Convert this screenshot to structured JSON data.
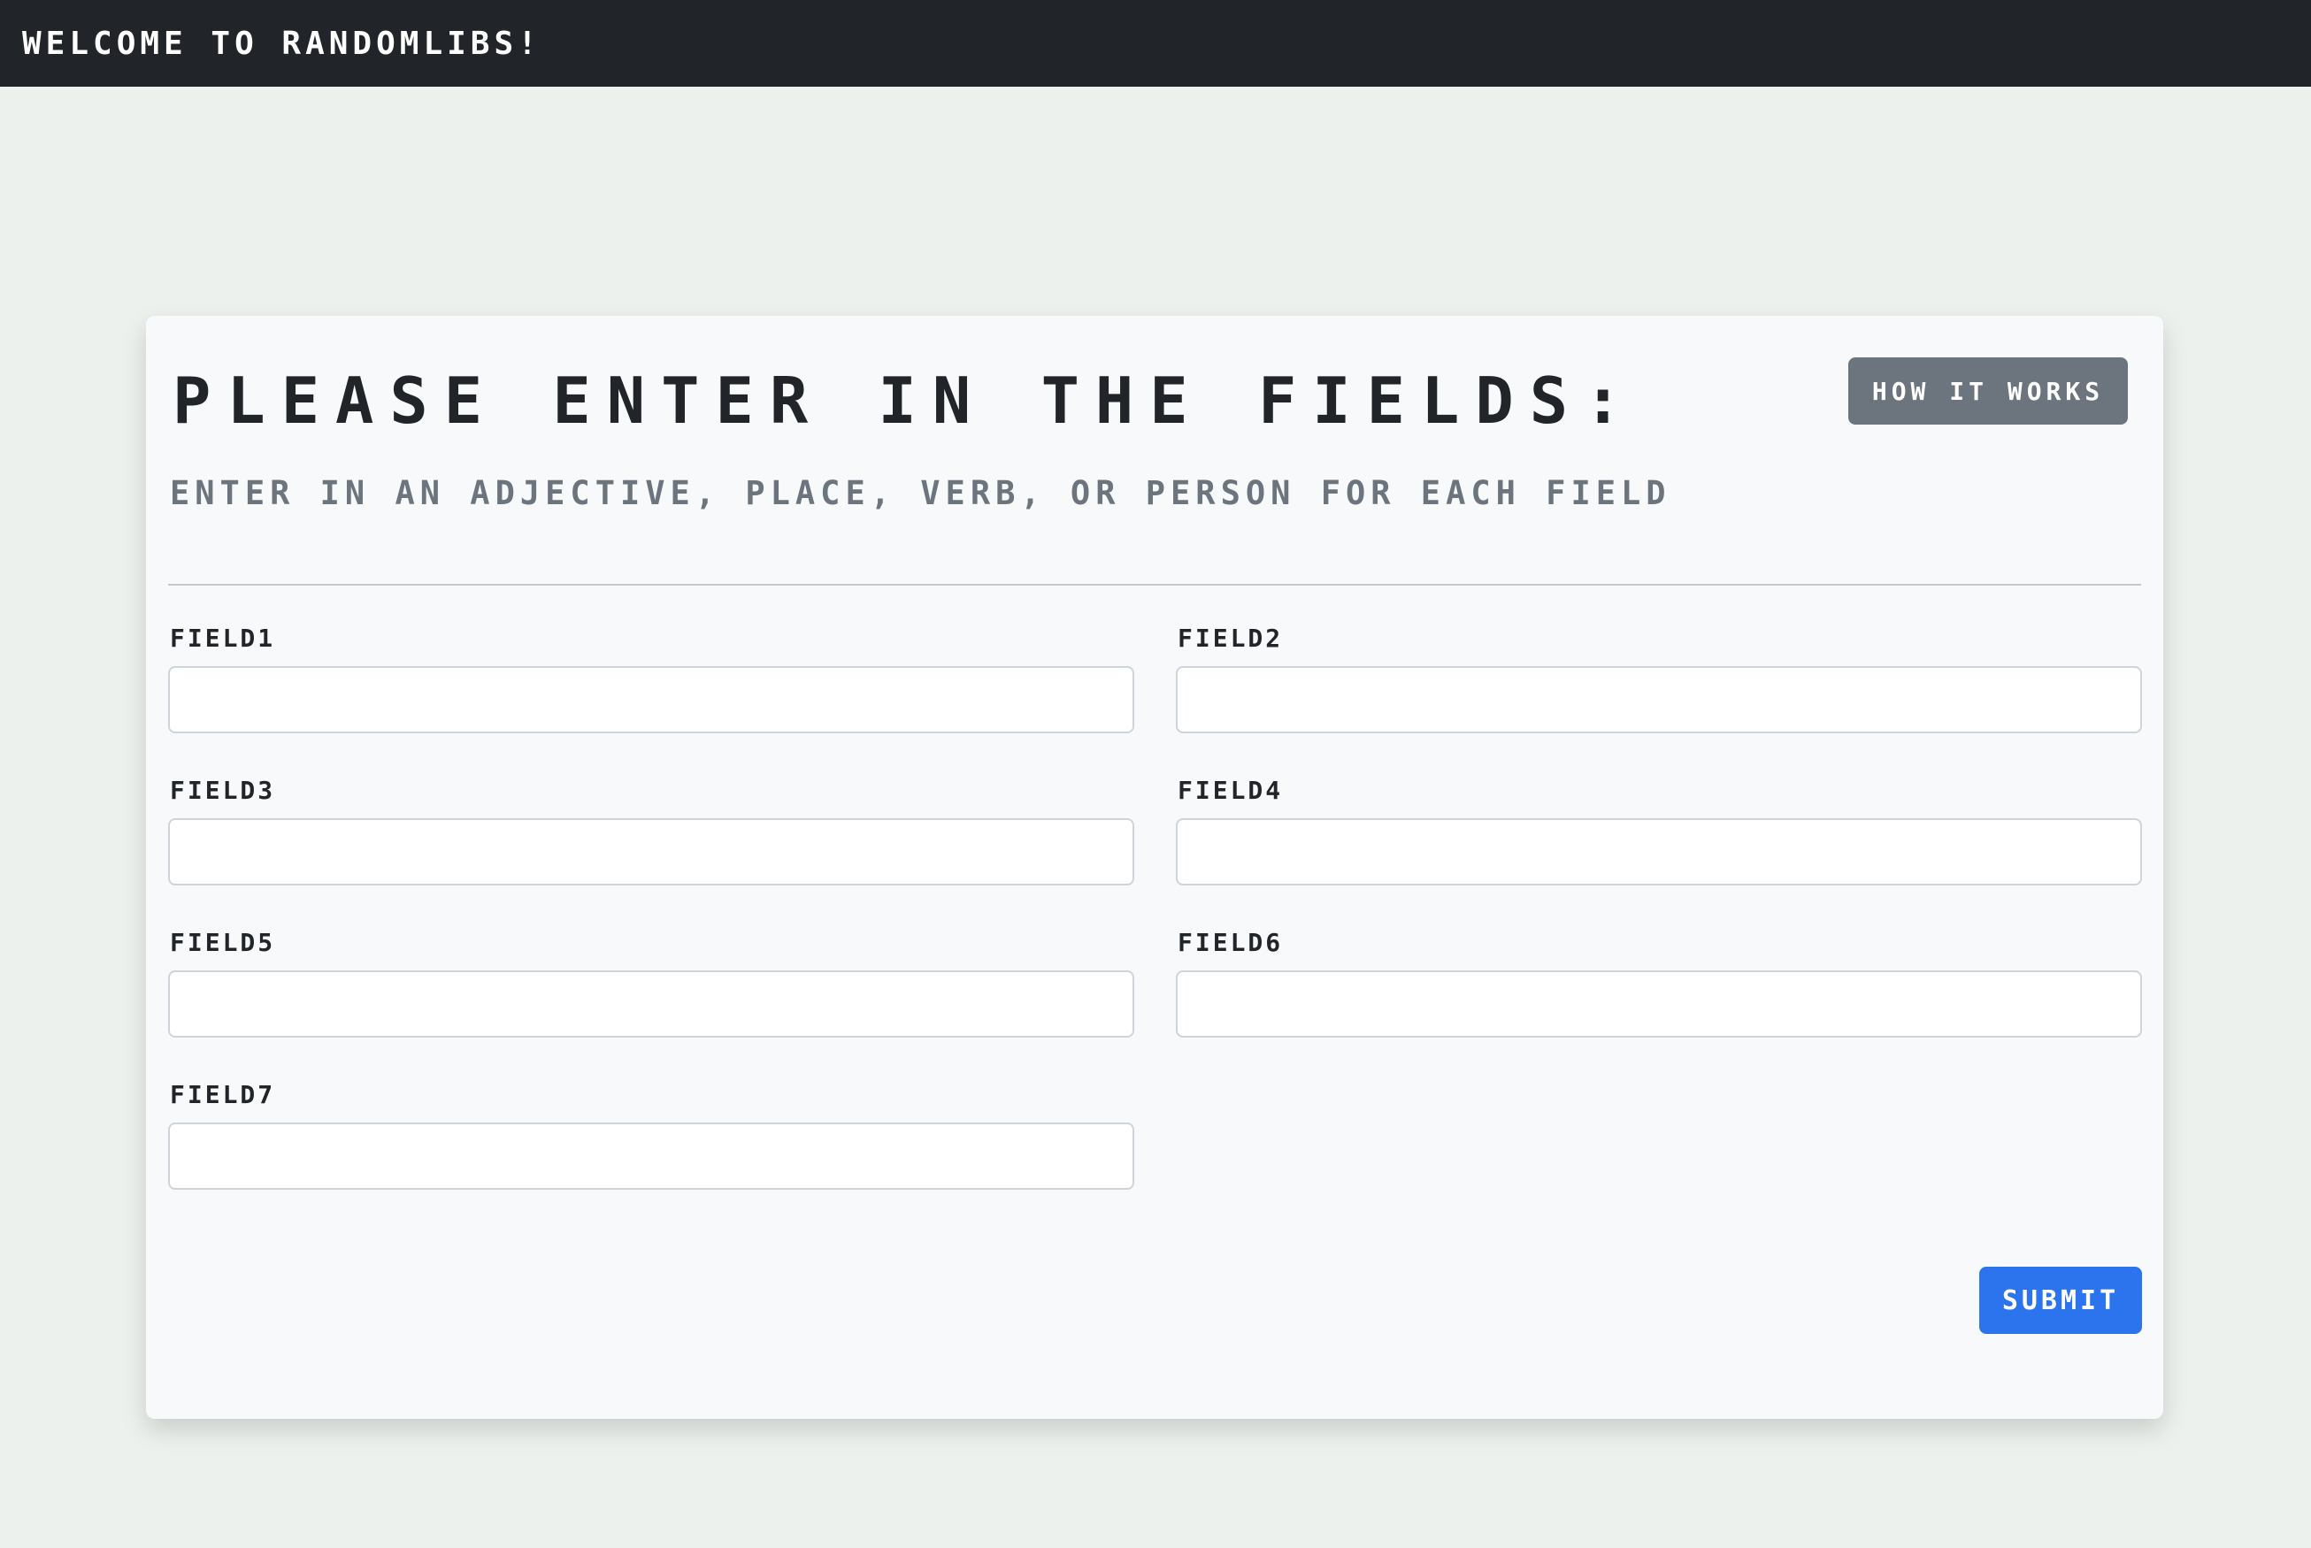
{
  "navbar": {
    "brand": "Welcome to RandomLibs!"
  },
  "card": {
    "title": "Please enter in the fields:",
    "how_it_works_label": "How it works",
    "subtitle": "Enter in an adjective, place, verb, or person for each field",
    "submit_label": "Submit"
  },
  "fields": [
    {
      "label": "field1",
      "value": ""
    },
    {
      "label": "field2",
      "value": ""
    },
    {
      "label": "field3",
      "value": ""
    },
    {
      "label": "field4",
      "value": ""
    },
    {
      "label": "field5",
      "value": ""
    },
    {
      "label": "field6",
      "value": ""
    },
    {
      "label": "field7",
      "value": ""
    }
  ],
  "colors": {
    "navbar_bg": "#212529",
    "page_bg": "#ecf1ed",
    "card_bg": "#f8f9fa",
    "secondary_button": "#6c757d",
    "primary_button": "#2b74ee"
  }
}
